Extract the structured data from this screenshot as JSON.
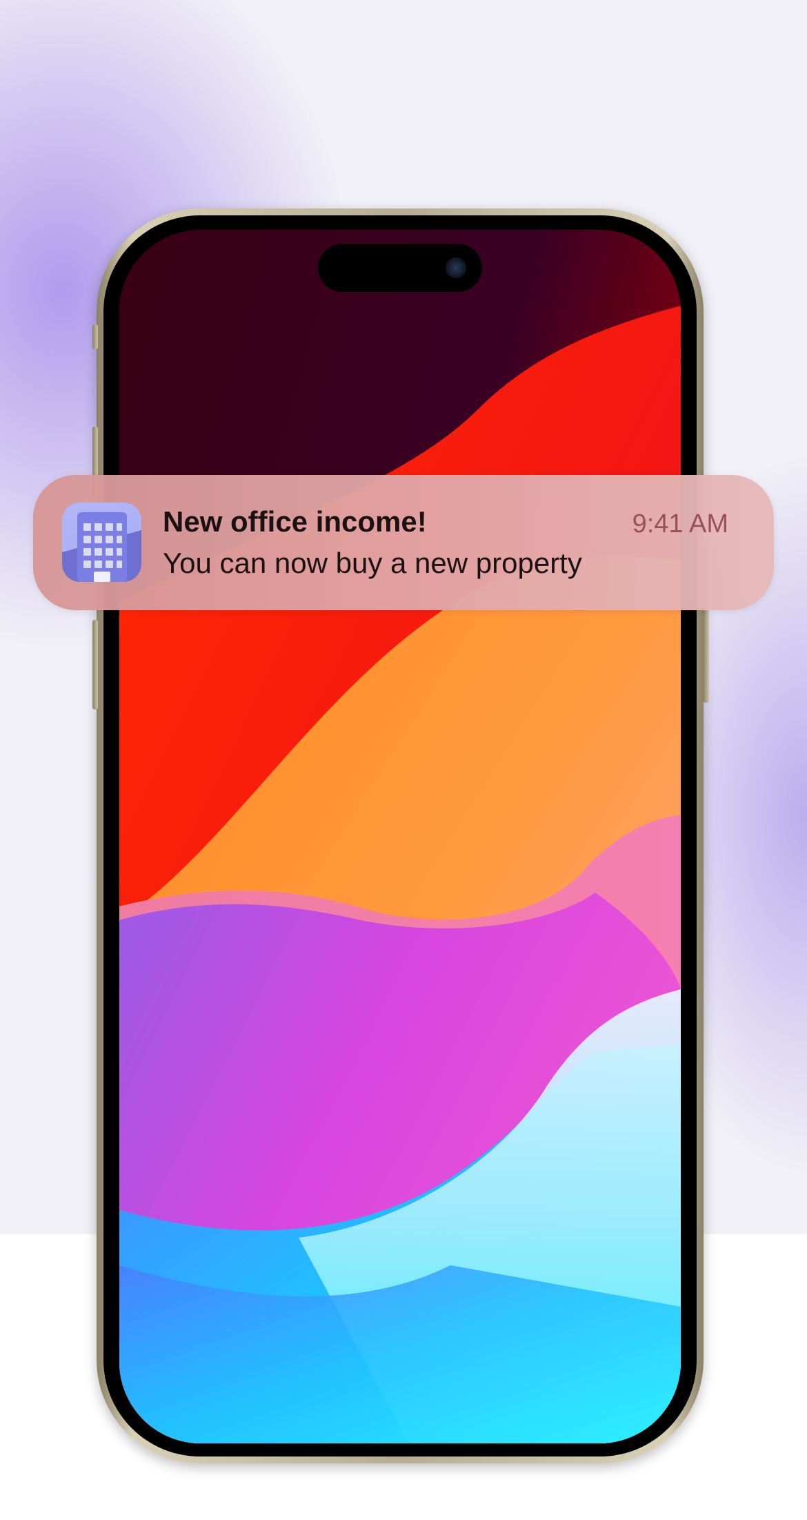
{
  "notification": {
    "app_icon": "office-building-icon",
    "title": "New office income!",
    "body": "You can now buy a new property",
    "time": "9:41 AM"
  },
  "colors": {
    "backdrop": "#f1f0f6",
    "backdrop_glow": "#a58ceb",
    "phone_frame": "#d8cfb5",
    "notification_bg": "#e2a8a8",
    "notification_text": "#1c1012",
    "notification_time": "#9a5058",
    "icon_bg": "#b3b6f7",
    "icon_building": "#7b7fe3"
  }
}
